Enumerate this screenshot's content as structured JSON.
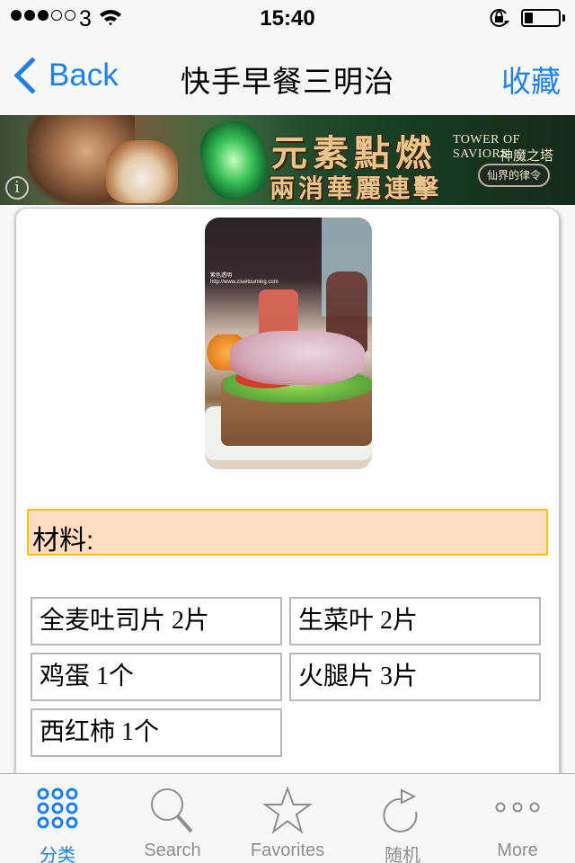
{
  "status_bar": {
    "signal_strength": 3,
    "signal_max": 5,
    "carrier": "3",
    "time": "15:40",
    "battery_level": 0.25,
    "icons": [
      "signal-dots-icon",
      "wifi-icon",
      "rotation-lock-icon",
      "battery-icon"
    ]
  },
  "nav": {
    "back_label": "Back",
    "title": "快手早餐三明治",
    "favorite_label": "收藏"
  },
  "ad_banner": {
    "headline_line1": "元素點燃",
    "headline_line2": "兩消華麗連擊",
    "brand": "TOWER OF SAVIORS",
    "brand_cn": "神魔之塔",
    "badge": "仙界的律令",
    "info_icon": "i"
  },
  "recipe": {
    "photo_alt": "sandwich-photo",
    "photo_watermark_line1": "紫色透明",
    "photo_watermark_line2": "http://www.ziseitouming.com",
    "section_label": "材料:",
    "ingredients": [
      "全麦吐司片 2片",
      "生菜叶 2片",
      "鸡蛋 1个",
      "火腿片 3片",
      "西红柿 1个"
    ]
  },
  "tab_bar": {
    "active_index": 0,
    "tabs": [
      {
        "label": "分类",
        "icon": "grid-dots-icon"
      },
      {
        "label": "Search",
        "icon": "search-icon"
      },
      {
        "label": "Favorites",
        "icon": "star-icon"
      },
      {
        "label": "随机",
        "icon": "refresh-icon"
      },
      {
        "label": "More",
        "icon": "more-icon"
      }
    ]
  },
  "colors": {
    "accent": "#1a82f0",
    "section_bg": "#fddcbf",
    "section_border": "#f5c518",
    "tab_inactive": "#8e8e8e"
  }
}
